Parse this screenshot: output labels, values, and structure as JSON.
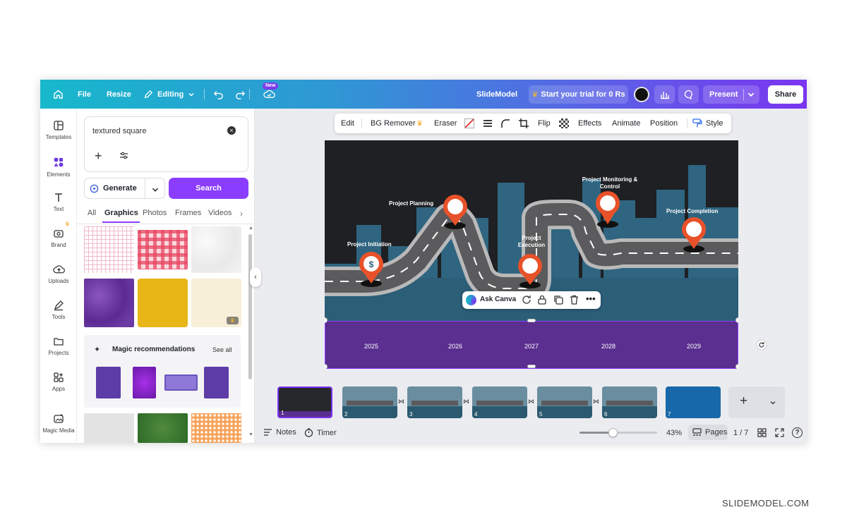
{
  "topbar": {
    "file": "File",
    "resize": "Resize",
    "editing": "Editing",
    "new_badge": "New",
    "doc_title": "SlideModel",
    "trial": "Start your trial for 0 Rs",
    "present": "Present",
    "share": "Share"
  },
  "sidebar": {
    "items": [
      {
        "label": "Templates",
        "icon": "templates-icon"
      },
      {
        "label": "Elements",
        "icon": "elements-icon"
      },
      {
        "label": "Text",
        "icon": "text-icon"
      },
      {
        "label": "Brand",
        "icon": "brand-icon"
      },
      {
        "label": "Uploads",
        "icon": "uploads-icon"
      },
      {
        "label": "Tools",
        "icon": "tools-icon"
      },
      {
        "label": "Projects",
        "icon": "projects-icon"
      },
      {
        "label": "Apps",
        "icon": "apps-icon"
      },
      {
        "label": "Magic Media",
        "icon": "magic-media-icon"
      }
    ]
  },
  "panel": {
    "search_value": "textured square",
    "generate": "Generate",
    "search": "Search",
    "tabs": [
      "All",
      "Graphics",
      "Photos",
      "Frames",
      "Videos"
    ],
    "active_tab": "Graphics",
    "magic_title": "Magic recommendations",
    "see_all": "See all"
  },
  "toolbar": {
    "edit": "Edit",
    "bg_remover": "BG Remover",
    "eraser": "Eraser",
    "flip": "Flip",
    "effects": "Effects",
    "animate": "Animate",
    "position": "Position",
    "style": "Style"
  },
  "slide": {
    "milestones": [
      "Project Initiation",
      "Project Planning",
      "Project Execution",
      "Project Monitoring & Control",
      "Project Completion"
    ],
    "years": [
      "2025",
      "2026",
      "2027",
      "2028",
      "2029"
    ],
    "ask_canva": "Ask Canva"
  },
  "pages": {
    "numbers": [
      "1",
      "2",
      "3",
      "4",
      "5",
      "6",
      "7"
    ]
  },
  "status": {
    "notes": "Notes",
    "timer": "Timer",
    "zoom": "43%",
    "zoom_level": 0.43,
    "pages_label": "Pages",
    "page_count": "1 / 7"
  },
  "watermark": "SLIDEMODEL.COM",
  "colors": {
    "accent": "#8b3dff",
    "brand_gradient_start": "#17b8cc",
    "brand_gradient_end": "#7a35f0",
    "pin": "#e8522a"
  }
}
